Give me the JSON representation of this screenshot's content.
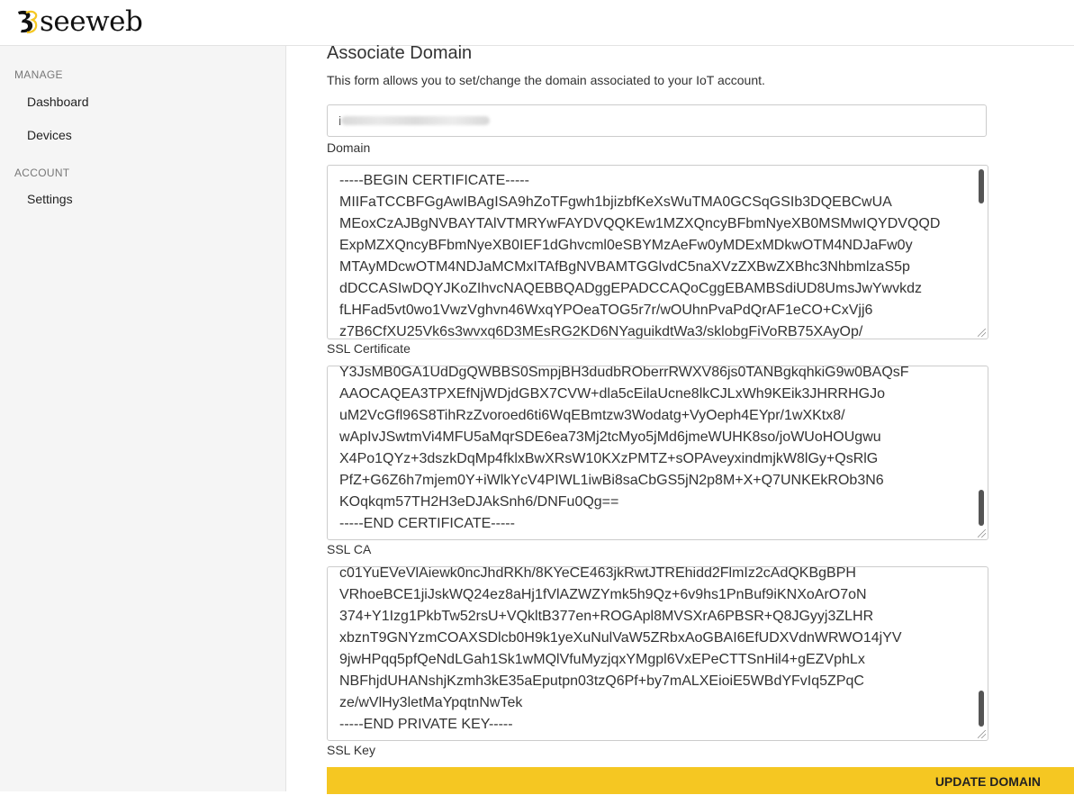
{
  "brand": {
    "name": "seeweb"
  },
  "sidebar": {
    "sections": [
      {
        "heading": "MANAGE",
        "items": [
          {
            "label": "Dashboard"
          },
          {
            "label": "Devices"
          }
        ]
      },
      {
        "heading": "ACCOUNT",
        "items": [
          {
            "label": "Settings"
          }
        ]
      }
    ]
  },
  "form": {
    "title": "Associate Domain",
    "description": "This form allows you to set/change the domain associated to your IoT account.",
    "domain": {
      "value": "i",
      "label": "Domain"
    },
    "ssl_certificate": {
      "label": "SSL Certificate",
      "lines": [
        "-----BEGIN CERTIFICATE-----",
        "MIIFaTCCBFGgAwIBAgISA9hZoTFgwh1bjizbfKeXsWuTMA0GCSqGSIb3DQEBCwUA",
        "MEoxCzAJBgNVBAYTAlVTMRYwFAYDVQQKEw1MZXQncyBFbmNyeXB0MSMwIQYDVQQD",
        "ExpMZXQncyBFbmNyeXB0IEF1dGhvcml0eSBYMzAeFw0yMDExMDkwOTM4NDJaFw0y",
        "MTAyMDcwOTM4NDJaMCMxITAfBgNVBAMTGGlvdC5naXVzZXBwZXBhc3NhbmlzaS5p",
        "dDCCASIwDQYJKoZIhvcNAQEBBQADggEPADCCAQoCggEBAMBSdiUD8UmsJwYwvkdz",
        "fLHFad5vt0wo1VwzVghvn46WxqYPOeaTOG5r7r/wOUhnPvaPdQrAF1eCO+CxVjj6",
        "z7B6CfXU25Vk6s3wvxq6D3MEsRG2KD6NYaguikdtWa3/sklobgFiVoRB75XAyOp/"
      ]
    },
    "ssl_ca": {
      "label": "SSL CA",
      "lines": [
        "Y3JsMB0GA1UdDgQWBBS0SmpjBH3dudbROberrRWXV86js0TANBgkqhkiG9w0BAQsF",
        "AAOCAQEA3TPXEfNjWDjdGBX7CVW+dla5cEilaUcne8lkCJLxWh9KEik3JHRRHGJo",
        "uM2VcGfl96S8TihRzZvoroed6ti6WqEBmtzw3Wodatg+VyOeph4EYpr/1wXKtx8/",
        "wApIvJSwtmVi4MFU5aMqrSDE6ea73Mj2tcMyo5jMd6jmeWUHK8so/joWUoHOUgwu",
        "X4Po1QYz+3dszkDqMp4fklxBwXRsW10KXzPMTZ+sOPAveyxindmjkW8lGy+QsRlG",
        "PfZ+G6Z6h7mjem0Y+iWlkYcV4PIWL1iwBi8saCbGS5jN2p8M+X+Q7UNKEkROb3N6",
        "KOqkqm57TH2H3eDJAkSnh6/DNFu0Qg==",
        "-----END CERTIFICATE-----"
      ]
    },
    "ssl_key": {
      "label": "SSL Key",
      "lines": [
        "c01YuEVeVlAiewk0ncJhdRKh/8KYeCE463jkRwtJTREhidd2FlmIz2cAdQKBgBPH",
        "VRhoeBCE1jiJskWQ24ez8aHj1fVlAZWZYmk5h9Qz+6v9hs1PnBuf9iKNXoArO7oN",
        "374+Y1Izg1PkbTw52rsU+VQkltB377en+ROGApl8MVSXrA6PBSR+Q8JGyyj3ZLHR",
        "xbznT9GNYzmCOAXSDlcb0H9k1yeXuNulVaW5ZRbxAoGBAI6EfUDXVdnWRWO14jYV",
        "9jwHPqq5pfQeNdLGah1Sk1wMQlVfuMyzjqxYMgpl6VxEPeCTTSnHil4+gEZVphLx",
        "NBFhjdUHANshjKzmh3kE35aEputpn03tzQ6Pf+by7mALXEioiE5WBdYFvIq5ZPqC",
        "ze/wVlHy3letMaYpqtnNwTek",
        "-----END PRIVATE KEY-----"
      ]
    },
    "submit_label": "UPDATE DOMAIN"
  }
}
